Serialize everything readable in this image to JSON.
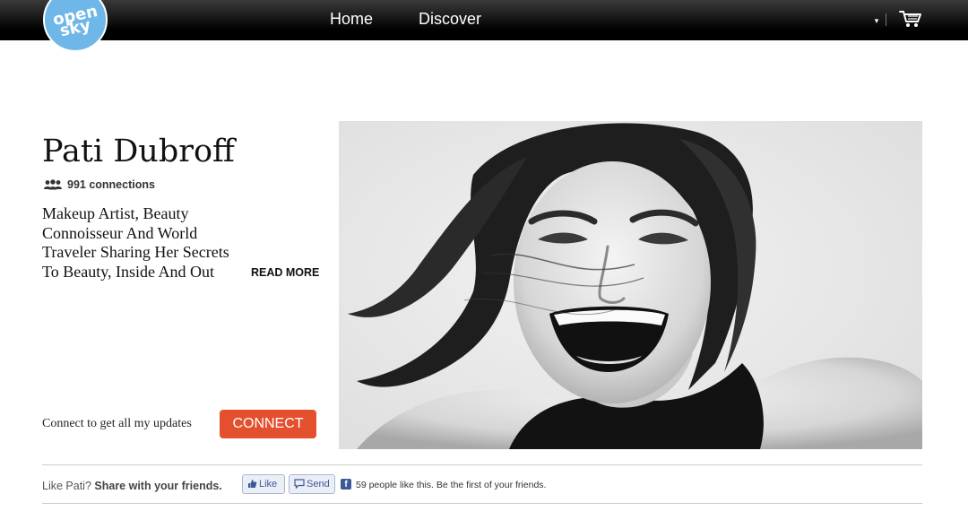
{
  "header": {
    "logo_line1": "open",
    "logo_line2": "sky",
    "nav": {
      "home": "Home",
      "discover": "Discover"
    },
    "dropdown_caret": "▾"
  },
  "profile": {
    "name": "Pati Dubroff",
    "connections_text": "991 connections",
    "bio": "Makeup Artist, Beauty Connoisseur And World Traveler Sharing Her Secrets To Beauty, Inside And Out",
    "read_more_label": "READ MORE",
    "connect_note": "Connect to get all my updates",
    "connect_label": "CONNECT"
  },
  "share": {
    "prompt": "Like Pati?",
    "prompt_bold": "Share with your friends.",
    "like_label": "Like",
    "send_label": "Send",
    "fb_glyph": "f",
    "like_count_text": "59 people like this. Be the first of your friends."
  },
  "colors": {
    "accent": "#e4502d",
    "logo": "#6fb7e8",
    "facebook": "#3b5998"
  }
}
